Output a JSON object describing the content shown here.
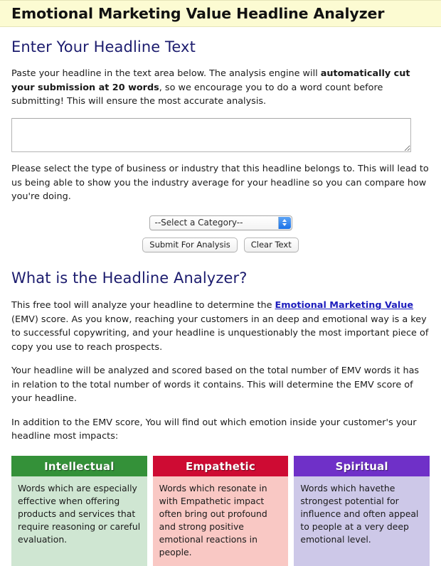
{
  "header": {
    "title": "Emotional Marketing Value Headline Analyzer",
    "background_color": "#fcfbd2"
  },
  "enter_headline": {
    "heading": "Enter Your Headline Text",
    "intro_part1": "Paste your headline in the text area below. The analysis engine will ",
    "intro_bold": "automatically cut your submission at 20 words",
    "intro_part2": ", so we encourage you to do a word count before submitting! This will ensure the most accurate analysis.",
    "textarea": {
      "value": "",
      "placeholder": ""
    },
    "category_instructions": "Please select the type of business or industry that this headline belongs to. This will lead to us being able to show you the industry average for your headline so you can compare how you're doing.",
    "category_select": {
      "selected": "--Select a Category--",
      "icon": "chevron-up-down-icon"
    },
    "submit_label": "Submit For Analysis",
    "clear_label": "Clear Text"
  },
  "about": {
    "heading": "What is the Headline Analyzer?",
    "para1_part1": "This free tool will analyze your headline to determine the ",
    "para1_link": "Emotional Marketing Value",
    "para1_part2": " (EMV) score. As you know, reaching your customers in an deep and emotional way is a key to successful copywriting, and your headline is unquestionably the most important piece of copy you use to reach prospects.",
    "para2": "Your headline will be analyzed and scored based on the total number of EMV words it has in relation to the total number of words it contains. This will determine the EMV score of your headline.",
    "para3": "In addition to the EMV score, You will find out which emotion inside your customer's your headline most impacts:",
    "link_color": "#1d1dbd"
  },
  "emotion_cards": [
    {
      "title": "Intellectual",
      "description": "Words which are especially effective when offering products and services that require reasoning or careful evaluation.",
      "header_color": "#349139",
      "body_color": "#cfe6d2"
    },
    {
      "title": "Empathetic",
      "description": "Words which resonate in with Empathetic impact often bring out profound and strong positive emotional reactions in people.",
      "header_color": "#ce0b33",
      "body_color": "#f9c8c4"
    },
    {
      "title": "Spiritual",
      "description": "Words which havethe strongest potential for influence and often appeal to people at a very deep emotional level.",
      "header_color": "#6f30c8",
      "body_color": "#cdc8e8"
    }
  ]
}
